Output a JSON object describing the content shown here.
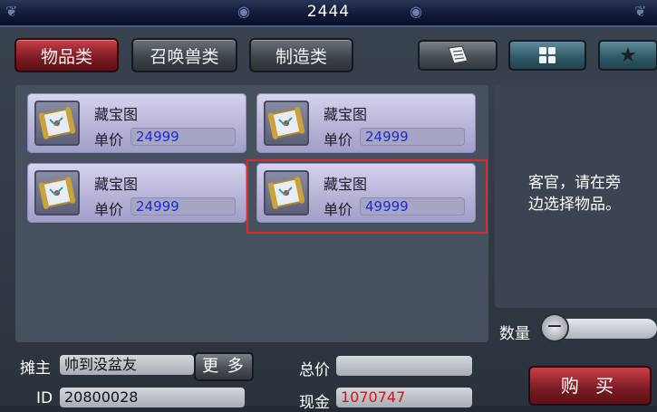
{
  "window": {
    "title": "2444"
  },
  "tabs": [
    {
      "label": "物品类",
      "active": true
    },
    {
      "label": "召唤兽类",
      "active": false
    },
    {
      "label": "制造类",
      "active": false
    }
  ],
  "icon_buttons": [
    {
      "icon": "scroll-book-icon"
    },
    {
      "icon": "grid-icon"
    },
    {
      "icon": "star-icon"
    }
  ],
  "items": [
    {
      "name": "藏宝图",
      "price_label": "单价",
      "price": "24999",
      "selected": false
    },
    {
      "name": "藏宝图",
      "price_label": "单价",
      "price": "24999",
      "selected": false
    },
    {
      "name": "藏宝图",
      "price_label": "单价",
      "price": "24999",
      "selected": false
    },
    {
      "name": "藏宝图",
      "price_label": "单价",
      "price": "49999",
      "selected": true
    }
  ],
  "info_panel": {
    "message_line1": "客官，请在旁",
    "message_line2": "边选择物品。"
  },
  "quantity": {
    "label": "数量",
    "minus": "−"
  },
  "seller": {
    "label": "摊主",
    "value": "帅到没盆友",
    "more_label": "更 多"
  },
  "id": {
    "label": "ID",
    "value": "20800028"
  },
  "total": {
    "label": "总价",
    "value": ""
  },
  "cash": {
    "label": "现金",
    "value": "1070747"
  },
  "buy_label": "购 买",
  "colors": {
    "price_text": "#1e2ad8",
    "cash_text": "#e01010",
    "selection_border": "#e02a2a"
  }
}
